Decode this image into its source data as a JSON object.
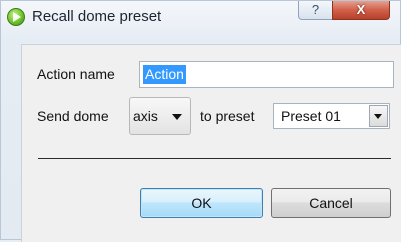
{
  "window": {
    "title": "Recall dome preset",
    "help_glyph": "?",
    "close_glyph": "X"
  },
  "form": {
    "action_name_label": "Action name",
    "action_name_value": "Action",
    "send_dome_label": "Send dome",
    "dome_dropdown_value": "axis",
    "to_preset_label": "to preset",
    "preset_value": "Preset 01"
  },
  "buttons": {
    "ok": "OK",
    "cancel": "Cancel"
  },
  "icons": {
    "app": "play-icon",
    "dropdown": "chevron-down-icon"
  }
}
